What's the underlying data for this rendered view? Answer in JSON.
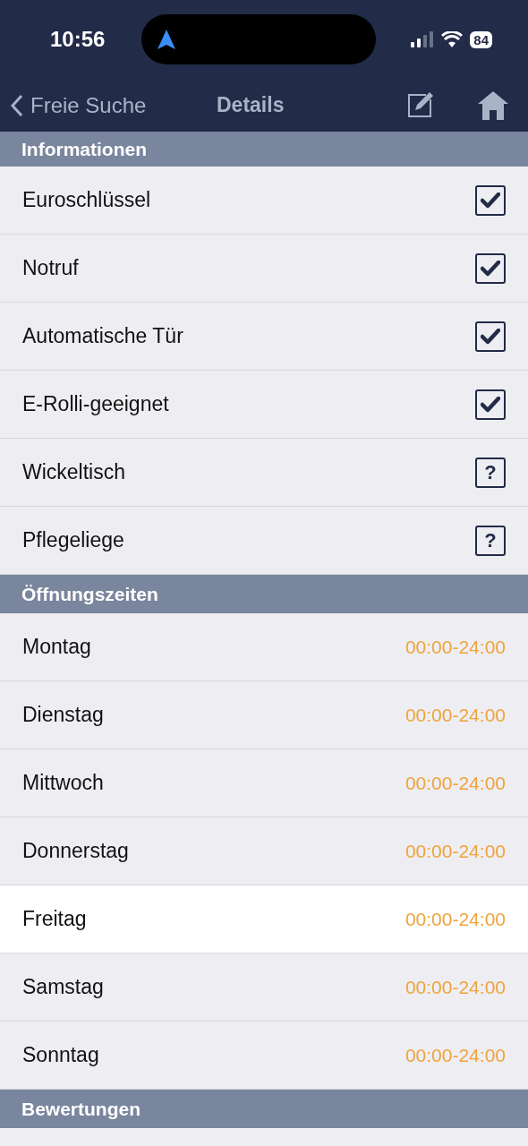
{
  "status_bar": {
    "time": "10:56",
    "battery": "84"
  },
  "nav": {
    "back": "Freie Suche",
    "title": "Details"
  },
  "sections": [
    {
      "title": "Informationen",
      "kind": "features",
      "items": [
        {
          "label": "Euroschlüssel",
          "kind": "checkbox",
          "checked": true
        },
        {
          "label": "Notruf",
          "kind": "checkbox",
          "checked": true
        },
        {
          "label": "Automatische Tür",
          "kind": "checkbox",
          "checked": true
        },
        {
          "label": "E-Rolli-geeignet",
          "kind": "checkbox",
          "checked": true
        },
        {
          "label": "Wickeltisch",
          "kind": "unknown",
          "symbol": "?"
        },
        {
          "label": "Pflegeliege",
          "kind": "unknown",
          "symbol": "?"
        }
      ]
    },
    {
      "title": "Öffnungszeiten",
      "kind": "hours",
      "items": [
        {
          "label": "Montag",
          "hours": "00:00-24:00",
          "selected": false
        },
        {
          "label": "Dienstag",
          "hours": "00:00-24:00",
          "selected": false
        },
        {
          "label": "Mittwoch",
          "hours": "00:00-24:00",
          "selected": false
        },
        {
          "label": "Donnerstag",
          "hours": "00:00-24:00",
          "selected": false
        },
        {
          "label": "Freitag",
          "hours": "00:00-24:00",
          "selected": true
        },
        {
          "label": "Samstag",
          "hours": "00:00-24:00",
          "selected": false
        },
        {
          "label": "Sonntag",
          "hours": "00:00-24:00",
          "selected": false
        }
      ]
    },
    {
      "title": "Bewertungen"
    }
  ]
}
